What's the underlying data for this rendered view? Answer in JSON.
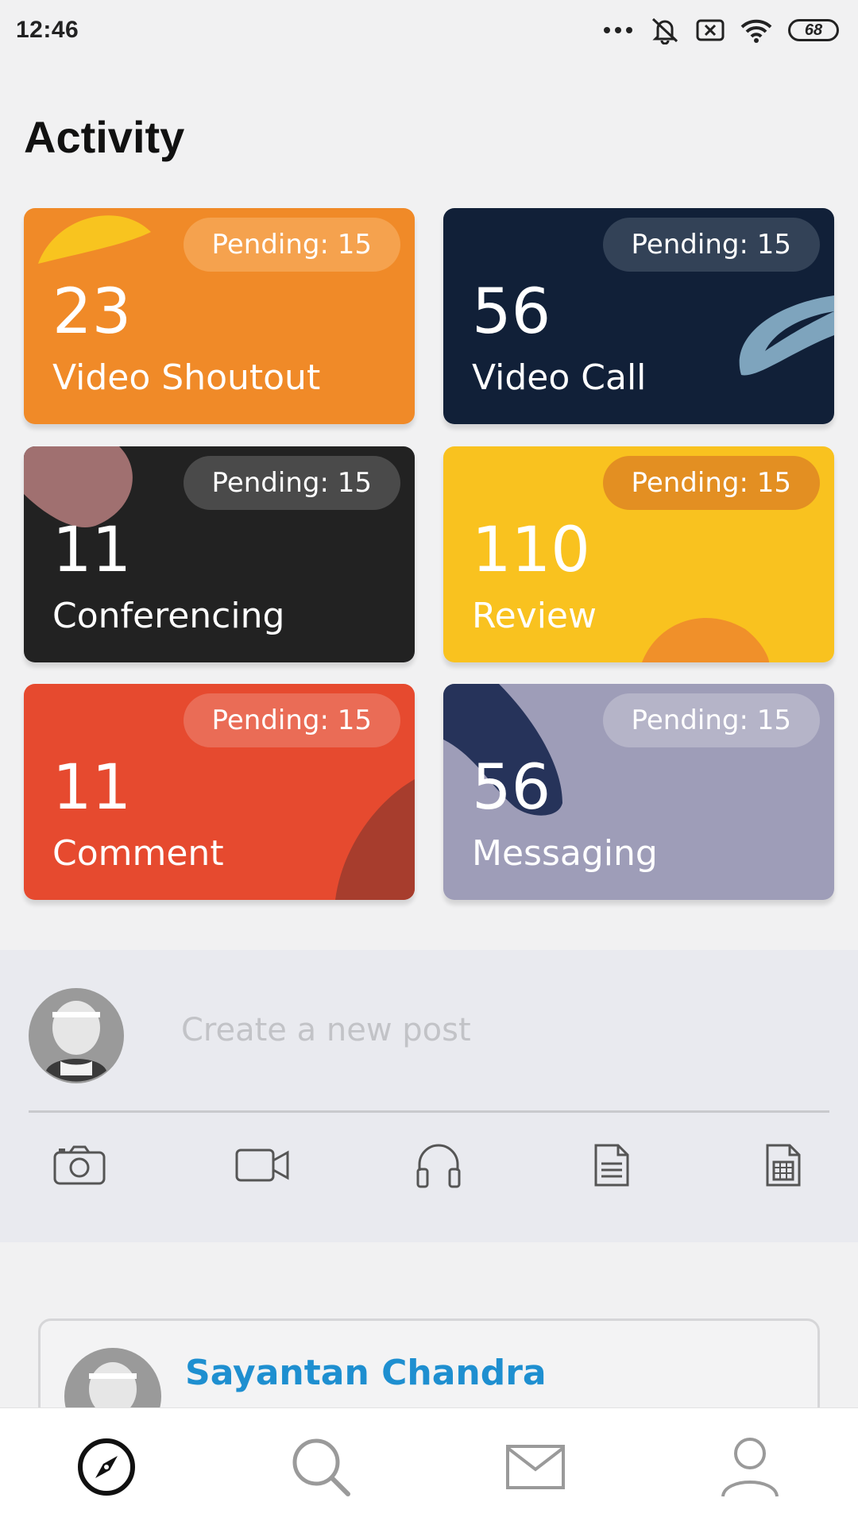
{
  "status_bar": {
    "time": "12:46",
    "battery": "68",
    "icons": [
      "more-dots-icon",
      "mute-icon",
      "sim-off-icon",
      "wifi-icon",
      "battery-icon"
    ]
  },
  "page_title": "Activity",
  "cards": [
    {
      "count": "23",
      "label": "Video Shoutout",
      "pending": "Pending: 15",
      "color": "#f08a28"
    },
    {
      "count": "56",
      "label": "Video Call",
      "pending": "Pending: 15",
      "color": "#112038"
    },
    {
      "count": "11",
      "label": "Conferencing",
      "pending": "Pending: 15",
      "color": "#222222"
    },
    {
      "count": "110",
      "label": "Review",
      "pending": "Pending: 15",
      "color": "#f9c21f"
    },
    {
      "count": "11",
      "label": "Comment",
      "pending": "Pending: 15",
      "color": "#e64a2f"
    },
    {
      "count": "56",
      "label": "Messaging",
      "pending": "Pending: 15",
      "color": "#9e9db8"
    }
  ],
  "composer": {
    "placeholder": "Create a new post",
    "tools": [
      "camera-icon",
      "video-icon",
      "headphones-icon",
      "document-icon",
      "spreadsheet-icon"
    ]
  },
  "post": {
    "author": "Sayantan Chandra"
  },
  "bottom_nav": {
    "items": [
      "explore-icon",
      "search-icon",
      "mail-icon",
      "profile-icon"
    ],
    "active": "explore-icon"
  }
}
